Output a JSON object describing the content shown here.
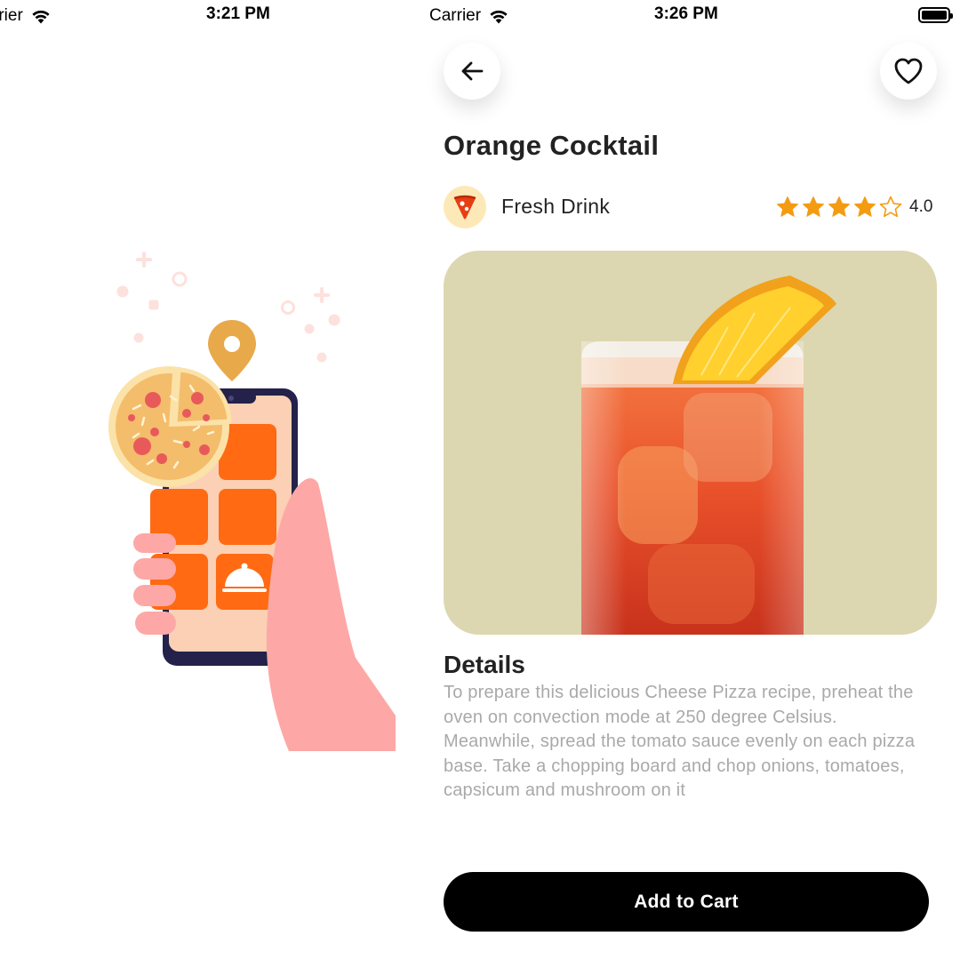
{
  "status_left": {
    "carrier": "rrier",
    "time": "3:21 PM"
  },
  "status_right": {
    "carrier": "Carrier",
    "time": "3:26 PM"
  },
  "illustration": {
    "name": "phone-food-order-illustration"
  },
  "header": {
    "back_icon": "arrow-left-icon",
    "favorite_icon": "heart-icon"
  },
  "product": {
    "title": "Orange Cocktail",
    "category": "Fresh Drink",
    "category_icon": "pizza-slice-icon",
    "rating": 4.0,
    "rating_label": "4.0",
    "rating_max": 5
  },
  "details": {
    "heading": "Details",
    "text": "To prepare this delicious Cheese Pizza recipe, preheat the oven on convection mode at 250 degree Celsius. Meanwhile, spread the tomato sauce evenly on each pizza base. Take a chopping board and chop onions, tomatoes, capsicum and mushroom on it"
  },
  "cart": {
    "label": "Add to Cart"
  },
  "colors": {
    "accent": "#f39c12",
    "primary_button": "#000000",
    "hero_bg": "#dcd7b0",
    "muted_text": "#a9a9a9",
    "illustration_orange": "#ff6a13"
  }
}
